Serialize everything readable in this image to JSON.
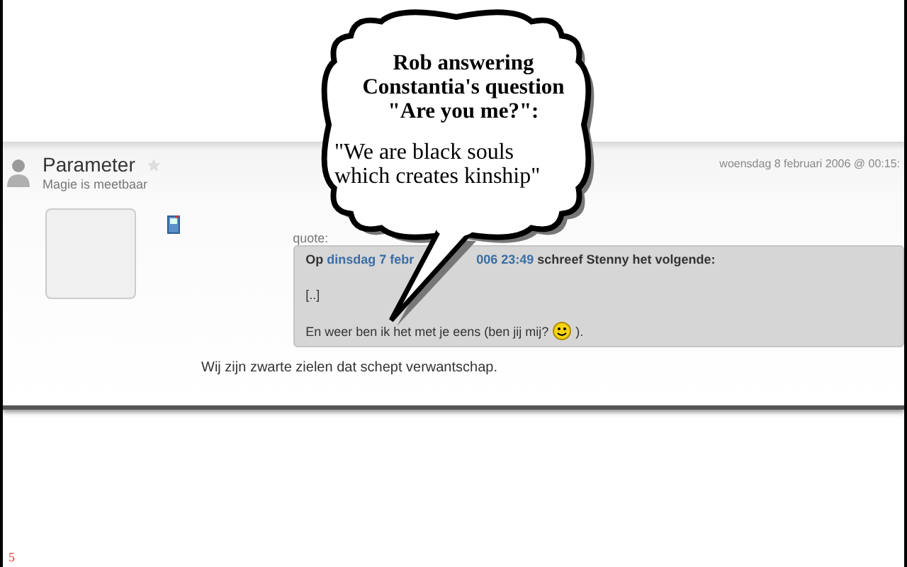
{
  "post": {
    "author": "Parameter",
    "subtitle": "Magie is meetbaar",
    "date": "woensdag 8 februari 2006 @ 00:15:",
    "quote_label": "quote:",
    "quote": {
      "header_prefix": "Op",
      "header_link_start": "dinsdag 7 febr",
      "header_link_end": "006 23:49",
      "header_rest": "schreef Stenny het volgende:",
      "lines": [
        "[..]",
        "En weer ben ik het met je eens (ben jij mij?"
      ],
      "after_smiley": ")."
    },
    "body": "Wij zijn zwarte zielen dat schept verwantschap."
  },
  "callout": {
    "title_lines": [
      "Rob answering",
      "Constantia's question",
      "\"Are you me?\":"
    ],
    "quote_lines": [
      "\"We are black souls",
      "which creates kinship\""
    ]
  },
  "slide": {
    "page_number": "5"
  }
}
